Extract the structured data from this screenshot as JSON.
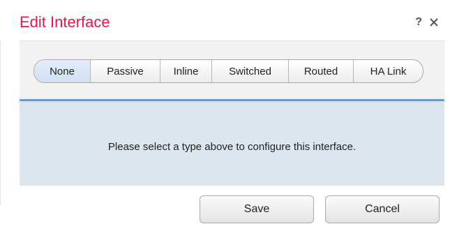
{
  "dialog": {
    "title": "Edit Interface",
    "help_icon": "?",
    "close_icon": "close-icon"
  },
  "interface_types": [
    {
      "label": "None",
      "selected": true
    },
    {
      "label": "Passive",
      "selected": false
    },
    {
      "label": "Inline",
      "selected": false
    },
    {
      "label": "Switched",
      "selected": false
    },
    {
      "label": "Routed",
      "selected": false
    },
    {
      "label": "HA Link",
      "selected": false
    }
  ],
  "message": "Please select a type above to configure this interface.",
  "buttons": {
    "save": "Save",
    "cancel": "Cancel"
  },
  "colors": {
    "title": "#e8174a",
    "divider": "#6b98cf",
    "message_panel": "#dde5ef",
    "selected_segment": "#d6e5f5"
  }
}
